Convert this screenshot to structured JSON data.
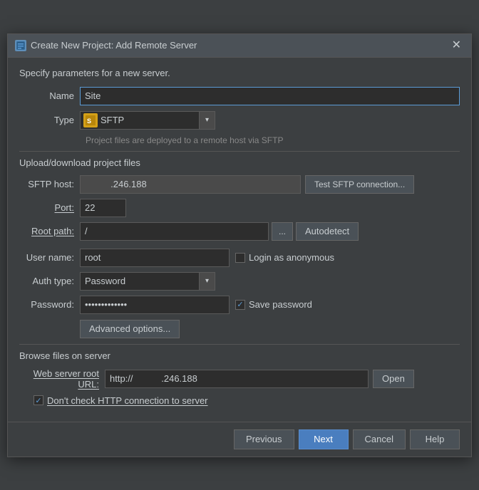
{
  "dialog": {
    "title": "Create New Project: Add Remote Server",
    "icon_label": "P",
    "intro": "Specify parameters for a new server."
  },
  "form": {
    "name_label": "Name",
    "name_value": "Site",
    "type_label": "Type",
    "type_value": "SFTP",
    "type_hint": "Project files are deployed to a remote host via SFTP"
  },
  "upload_section": {
    "header": "Upload/download project files",
    "sftp_host_label": "SFTP host:",
    "sftp_host_value": ".246.188",
    "sftp_host_prefix": "",
    "test_button": "Test SFTP connection...",
    "port_label": "Port:",
    "port_value": "22",
    "root_path_label": "Root path:",
    "root_path_value": "/",
    "browse_label": "...",
    "autodetect_label": "Autodetect",
    "user_name_label": "User name:",
    "user_name_value": "root",
    "login_anon_label": "Login as anonymous",
    "auth_type_label": "Auth type:",
    "auth_type_value": "Password",
    "password_label": "Password:",
    "password_value": "••••••••••••",
    "save_password_label": "Save password",
    "advanced_button": "Advanced options..."
  },
  "browse_section": {
    "header": "Browse files on server",
    "web_url_label": "Web server root URL:",
    "web_url_value": "http://           .246.188",
    "open_button": "Open",
    "dont_check_label": "Don't check HTTP connection to server"
  },
  "footer": {
    "previous_label": "Previous",
    "next_label": "Next",
    "cancel_label": "Cancel",
    "help_label": "Help"
  }
}
